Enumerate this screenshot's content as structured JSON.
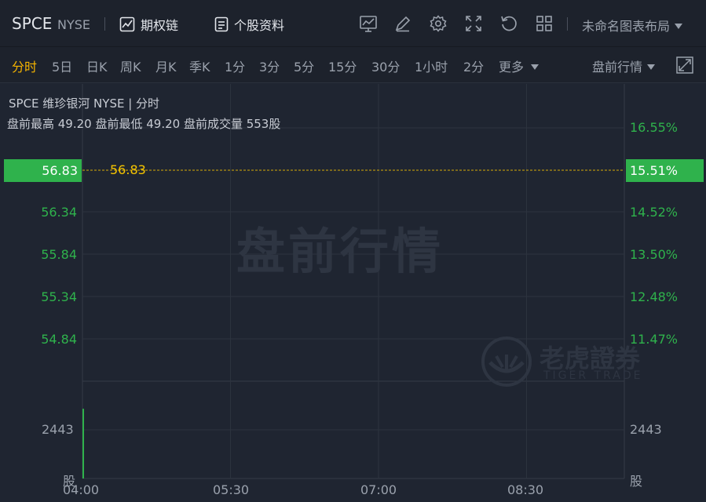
{
  "header": {
    "symbol": "SPCE",
    "exchange": "NYSE",
    "options_chain": "期权链",
    "profile": "个股资料",
    "layout_name": "未命名图表布局"
  },
  "periods": [
    "分时",
    "5日",
    "日K",
    "周K",
    "月K",
    "季K",
    "1分",
    "3分",
    "5分",
    "15分",
    "30分",
    "1小时",
    "2分"
  ],
  "active_period": "分时",
  "more_label": "更多",
  "premarket_selector": "盘前行情",
  "info": {
    "line1": "SPCE 维珍银河 NYSE | 分时",
    "line2": "盘前最高 49.20 盘前最低 49.20 盘前成交量 553股"
  },
  "current": {
    "price": "56.83",
    "price_label": "56.83",
    "pct": "15.51%"
  },
  "watermark": "盘前行情",
  "logo": {
    "name": "老虎證券",
    "sub": "TIGER TRADE"
  },
  "colors": {
    "up": "#2fb24c",
    "current_line": "#f5c400",
    "background": "#1f2531"
  },
  "chart_data": {
    "type": "line",
    "price_ticks": [
      "56.83",
      "56.34",
      "55.84",
      "55.34",
      "54.84"
    ],
    "pct_ticks": [
      "16.55%",
      "15.51%",
      "14.52%",
      "13.50%",
      "12.48%",
      "11.47%"
    ],
    "volume_tick": "2443",
    "volume_unit": "股",
    "x_ticks": [
      "04:00",
      "05:30",
      "07:00",
      "08:30"
    ],
    "current_price": 56.83,
    "volume_bars": [
      {
        "time": "04:00",
        "value": 3500
      }
    ]
  }
}
